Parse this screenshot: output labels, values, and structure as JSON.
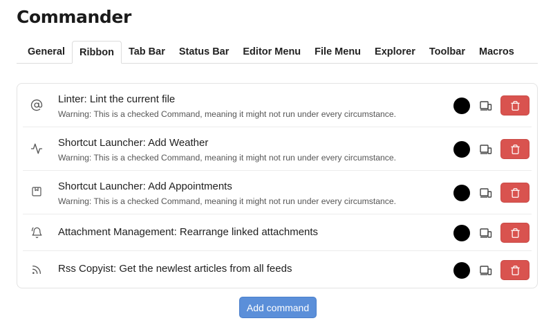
{
  "header": {
    "title": "Commander"
  },
  "tabs": [
    {
      "label": "General",
      "active": false
    },
    {
      "label": "Ribbon",
      "active": true
    },
    {
      "label": "Tab Bar",
      "active": false
    },
    {
      "label": "Status Bar",
      "active": false
    },
    {
      "label": "Editor Menu",
      "active": false
    },
    {
      "label": "File Menu",
      "active": false
    },
    {
      "label": "Explorer",
      "active": false
    },
    {
      "label": "Toolbar",
      "active": false
    },
    {
      "label": "Macros",
      "active": false
    }
  ],
  "commands": [
    {
      "icon": "at-sign-icon",
      "name": "Linter: Lint the current file",
      "warning": "Warning: This is a checked Command, meaning it might not run under every circumstance."
    },
    {
      "icon": "activity-icon",
      "name": "Shortcut Launcher: Add Weather",
      "warning": "Warning: This is a checked Command, meaning it might not run under every circumstance."
    },
    {
      "icon": "bookmark-box-icon",
      "name": "Shortcut Launcher: Add Appointments",
      "warning": "Warning: This is a checked Command, meaning it might not run under every circumstance."
    },
    {
      "icon": "bell-icon",
      "name": "Attachment Management: Rearrange linked attachments",
      "warning": ""
    },
    {
      "icon": "rss-icon",
      "name": "Rss Copyist: Get the newlest articles from all feeds",
      "warning": ""
    }
  ],
  "colors": {
    "command_color": "#000000",
    "delete_button": "#d9534f",
    "add_button": "#5b8fd9"
  },
  "add_button": {
    "label": "Add command"
  }
}
